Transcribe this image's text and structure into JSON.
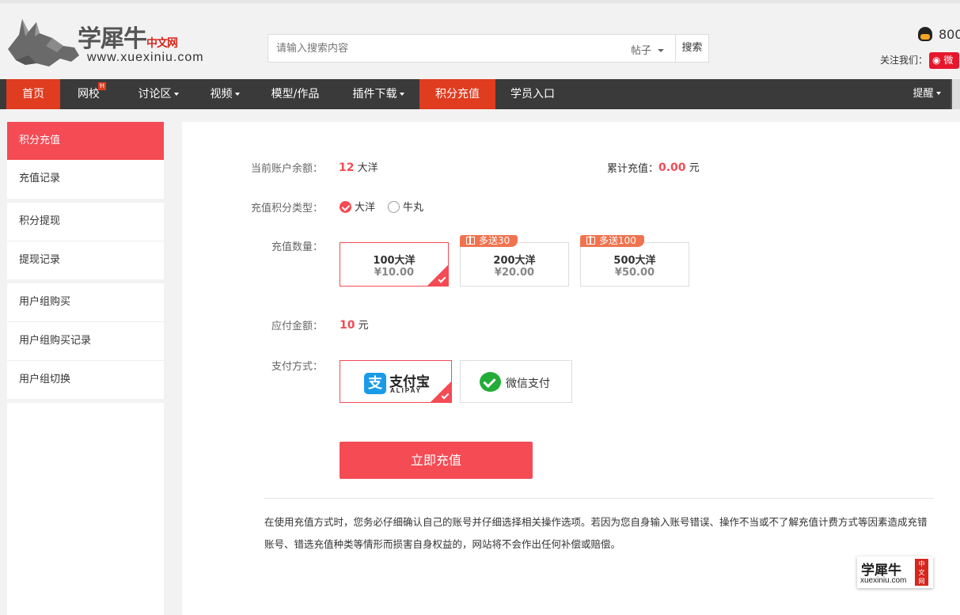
{
  "header": {
    "logo_cn_prefix": "学犀牛",
    "logo_cn_red": "中文网",
    "logo_url": "www.xuexiniu.com",
    "search_placeholder": "请输入搜索内容",
    "search_type": "帖子",
    "search_button": "搜索",
    "qq_number": "800",
    "follow_label": "关注我们：",
    "weibo_label": "微"
  },
  "nav": {
    "items": [
      {
        "label": "首页"
      },
      {
        "label": "网校",
        "badge": "H"
      },
      {
        "label": "讨论区"
      },
      {
        "label": "视频"
      },
      {
        "label": "模型/作品"
      },
      {
        "label": "插件下载"
      },
      {
        "label": "积分充值"
      },
      {
        "label": "学员入口"
      }
    ],
    "remind": "提醒"
  },
  "sidebar": {
    "items": [
      {
        "label": "积分充值"
      },
      {
        "label": "充值记录"
      },
      {
        "label": "积分提现"
      },
      {
        "label": "提现记录"
      },
      {
        "label": "用户组购买"
      },
      {
        "label": "用户组购买记录"
      },
      {
        "label": "用户组切换"
      }
    ]
  },
  "main": {
    "balance_label": "当前账户余额：",
    "balance_value": "12",
    "balance_unit": "大洋",
    "total_label": "累计充值：",
    "total_value": "0.00",
    "total_unit": "元",
    "type_label": "充值积分类型：",
    "type_options": [
      {
        "label": "大洋",
        "selected": true
      },
      {
        "label": "牛丸",
        "selected": false
      }
    ],
    "amount_label": "充值数量：",
    "packages": [
      {
        "name": "100大洋",
        "price": "¥10.00",
        "bonus": "",
        "selected": true
      },
      {
        "name": "200大洋",
        "price": "¥20.00",
        "bonus": "多送30",
        "selected": false
      },
      {
        "name": "500大洋",
        "price": "¥50.00",
        "bonus": "多送100",
        "selected": false
      }
    ],
    "due_label": "应付金额：",
    "due_value": "10",
    "due_unit": "元",
    "pay_label": "支付方式：",
    "pay_methods": {
      "alipay_cn": "支付宝",
      "alipay_en": "ALIPAY",
      "alipay_glyph": "支",
      "wechat": "微信支付"
    },
    "submit_label": "立即充值",
    "notice": "在使用充值方式时，您务必仔细确认自己的账号并仔细选择相关操作选项。若因为您自身输入账号错误、操作不当或不了解充值计费方式等因素造成充错账号、错选充值种类等情形而损害自身权益的，网站将不会作出任何补偿或赔偿。",
    "mini_logo_cn": "学犀牛",
    "mini_logo_red": "中文网",
    "mini_logo_url": "xuexiniu.com"
  },
  "colors": {
    "accent": "#f44b54",
    "nav_bg": "#3a3a3a",
    "nav_active": "#e03c1f",
    "badge": "#f0734f"
  }
}
